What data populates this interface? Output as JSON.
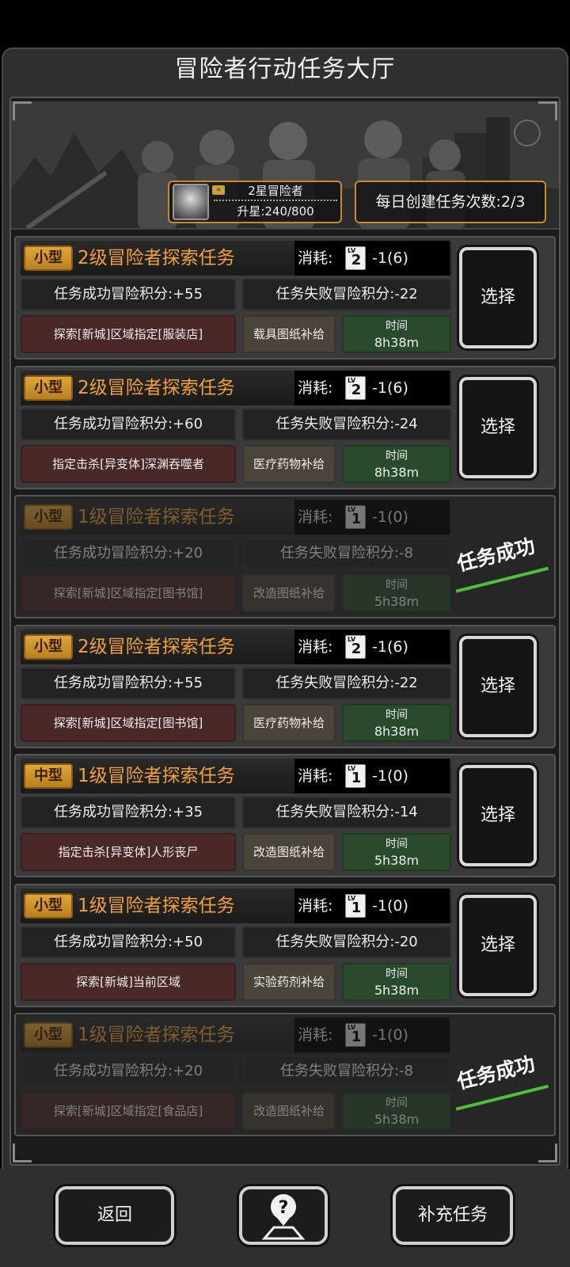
{
  "title": "冒险者行动任务大厅",
  "rank": {
    "name": "2星冒险者",
    "star_progress": "升星:240/800",
    "icon": "double-chevron-icon"
  },
  "daily": {
    "text": "每日创建任务次数:2/3"
  },
  "cost_label": "消耗:",
  "select_label": "选择",
  "stamp_label": "任务成功",
  "time_label": "时间",
  "tasks": [
    {
      "type": "小型",
      "name": "2级冒险者探索任务",
      "lv": "2",
      "cost": "-1(6)",
      "success": "任务成功冒险积分:+55",
      "fail": "任务失败冒险积分:-22",
      "target": "探索[新城]区域指定[服装店]",
      "reward": "载具图纸补给",
      "time": "8h38m",
      "status": "available"
    },
    {
      "type": "小型",
      "name": "2级冒险者探索任务",
      "lv": "2",
      "cost": "-1(6)",
      "success": "任务成功冒险积分:+60",
      "fail": "任务失败冒险积分:-24",
      "target": "指定击杀[异变体]深渊吞噬者",
      "reward": "医疗药物补给",
      "time": "8h38m",
      "status": "available"
    },
    {
      "type": "小型",
      "name": "1级冒险者探索任务",
      "lv": "1",
      "cost": "-1(0)",
      "success": "任务成功冒险积分:+20",
      "fail": "任务失败冒险积分:-8",
      "target": "探索[新城]区域指定[图书馆]",
      "reward": "改造图纸补给",
      "time": "5h38m",
      "status": "completed"
    },
    {
      "type": "小型",
      "name": "2级冒险者探索任务",
      "lv": "2",
      "cost": "-1(6)",
      "success": "任务成功冒险积分:+55",
      "fail": "任务失败冒险积分:-22",
      "target": "探索[新城]区域指定[图书馆]",
      "reward": "医疗药物补给",
      "time": "8h38m",
      "status": "available"
    },
    {
      "type": "中型",
      "name": "1级冒险者探索任务",
      "lv": "1",
      "cost": "-1(0)",
      "success": "任务成功冒险积分:+35",
      "fail": "任务失败冒险积分:-14",
      "target": "指定击杀[异变体]人形丧尸",
      "reward": "改造图纸补给",
      "time": "5h38m",
      "status": "available"
    },
    {
      "type": "小型",
      "name": "1级冒险者探索任务",
      "lv": "1",
      "cost": "-1(0)",
      "success": "任务成功冒险积分:+50",
      "fail": "任务失败冒险积分:-20",
      "target": "探索[新城]当前区域",
      "reward": "实验药剂补给",
      "time": "5h38m",
      "status": "available"
    },
    {
      "type": "小型",
      "name": "1级冒险者探索任务",
      "lv": "1",
      "cost": "-1(0)",
      "success": "任务成功冒险积分:+20",
      "fail": "任务失败冒险积分:-8",
      "target": "探索[新城]区域指定[食品店]",
      "reward": "改造图纸补给",
      "time": "5h38m",
      "status": "completed"
    }
  ],
  "bottom": {
    "back_label": "返回",
    "help_icon": "help-map-icon",
    "refill_label": "补充任务"
  }
}
